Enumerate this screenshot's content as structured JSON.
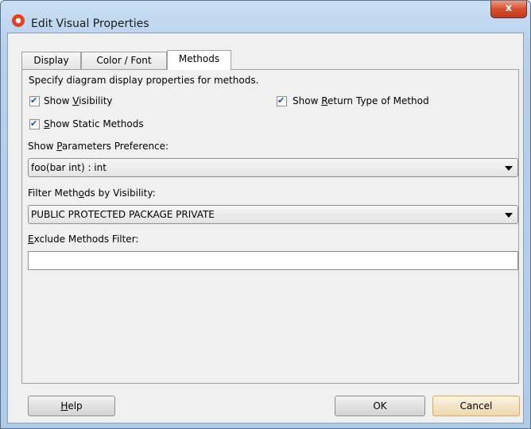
{
  "window": {
    "title": "Edit Visual Properties",
    "close_label": "x"
  },
  "tabs": [
    {
      "label": "Display",
      "active": false
    },
    {
      "label": "Color / Font",
      "active": false
    },
    {
      "label": "Methods",
      "active": true
    }
  ],
  "panel": {
    "description": "Specify diagram display properties for methods.",
    "show_visibility": {
      "pre": "Show ",
      "mnemonic": "V",
      "post": "isibility",
      "checked": true
    },
    "show_return_type": {
      "pre": "Show ",
      "mnemonic": "R",
      "post": "eturn Type of Method",
      "checked": true
    },
    "show_static": {
      "pre": "",
      "mnemonic": "S",
      "post": "how Static Methods",
      "checked": true
    },
    "params_label": {
      "pre": "Show ",
      "mnemonic": "P",
      "post": "arameters Preference:"
    },
    "params_value": "foo(bar int) : int",
    "filter_label": {
      "pre": "Filter Meth",
      "mnemonic": "o",
      "post": "ds by Visibility:"
    },
    "filter_value": "PUBLIC PROTECTED PACKAGE PRIVATE",
    "exclude_label": {
      "pre": "",
      "mnemonic": "E",
      "post": "xclude Methods Filter:"
    },
    "exclude_value": ""
  },
  "buttons": {
    "help": {
      "pre": "",
      "mnemonic": "H",
      "post": "elp"
    },
    "ok": "OK",
    "cancel": "Cancel"
  },
  "colors": {
    "accent_check": "#1f4f9a",
    "default_button_border": "#dba85c",
    "close_button": "#c2391b"
  }
}
